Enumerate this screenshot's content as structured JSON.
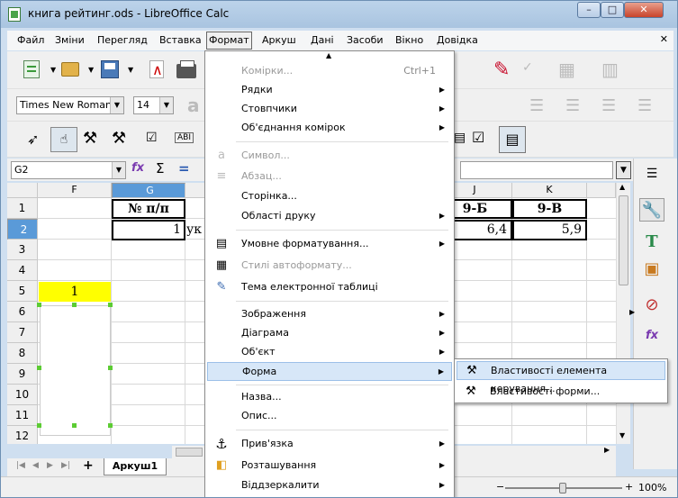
{
  "window": {
    "title": "книга рейтинг.ods - LibreOffice Calc",
    "min": "–",
    "max": "□",
    "close": "✕"
  },
  "menubar": {
    "items": [
      "Файл",
      "Зміни",
      "Перегляд",
      "Вставка",
      "Формат",
      "Аркуш",
      "Дані",
      "Засоби",
      "Вікно",
      "Довідка"
    ],
    "close": "✕"
  },
  "toolbar": {
    "font_name": "Times New Roman",
    "font_size": "14"
  },
  "formula_bar": {
    "name_box": "G2",
    "fx": "fx",
    "sigma": "Σ",
    "equals": "="
  },
  "grid": {
    "columns": [
      "F",
      "G",
      "J",
      "K"
    ],
    "rows": [
      "1",
      "2",
      "3",
      "4",
      "5",
      "6",
      "7",
      "8",
      "9",
      "10",
      "11",
      "12"
    ],
    "cells": {
      "G1": "№ п/п",
      "G2": "1",
      "G2_overflow": "ук",
      "J1": "9-Б",
      "J2": "6,4",
      "K1": "9-В",
      "K2": "5,9",
      "F5": "1"
    }
  },
  "sheet_tabs": {
    "add": "+",
    "active": "Аркуш1"
  },
  "status": {
    "zoom": "100%"
  },
  "format_menu": {
    "items": [
      {
        "label": "Комірки...",
        "accel": "Ctrl+1",
        "disabled": true
      },
      {
        "label": "Рядки",
        "submenu": true
      },
      {
        "label": "Стовпчики",
        "submenu": true
      },
      {
        "label": "Об'єднання комірок",
        "submenu": true
      },
      {
        "label": "Символ...",
        "disabled": true
      },
      {
        "label": "Абзац...",
        "disabled": true
      },
      {
        "label": "Сторінка..."
      },
      {
        "label": "Області друку",
        "submenu": true
      },
      {
        "label": "Умовне форматування...",
        "submenu": true
      },
      {
        "label": "Стилі автоформату...",
        "disabled": true
      },
      {
        "label": "Тема електронної таблиці"
      },
      {
        "label": "Зображення",
        "submenu": true
      },
      {
        "label": "Діаграма",
        "submenu": true
      },
      {
        "label": "Об'єкт",
        "submenu": true
      },
      {
        "label": "Форма",
        "submenu": true,
        "highlighted": true
      },
      {
        "label": "Назва..."
      },
      {
        "label": "Опис..."
      },
      {
        "label": "Прив'язка",
        "submenu": true
      },
      {
        "label": "Розташування",
        "submenu": true
      },
      {
        "label": "Віддзеркалити",
        "submenu": true
      }
    ]
  },
  "form_submenu": {
    "items": [
      "Властивості елемента керування...",
      "Властивості форми..."
    ]
  }
}
